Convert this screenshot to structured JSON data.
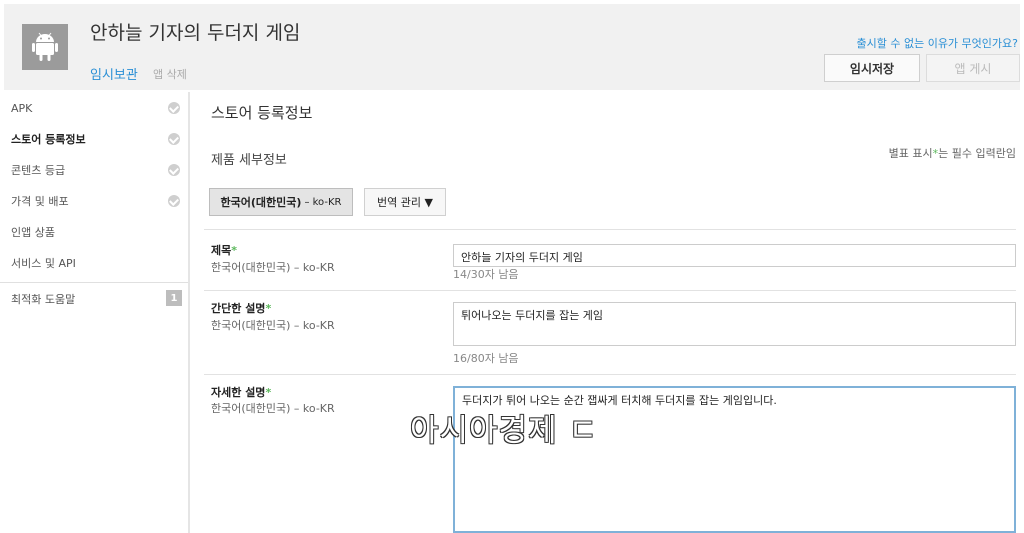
{
  "header": {
    "app_title": "안하늘 기자의 두더지 게임",
    "draft_label": "임시보관",
    "delete_label": "앱 삭제",
    "why_link": "출시할 수 없는 이유가 무엇인가요?",
    "save_label": "임시저장",
    "publish_label": "앱 게시"
  },
  "sidebar": {
    "items": [
      {
        "label": "APK",
        "checked": true
      },
      {
        "label": "스토어 등록정보",
        "checked": true,
        "active": true
      },
      {
        "label": "콘텐츠 등급",
        "checked": true
      },
      {
        "label": "가격 및 배포",
        "checked": true
      },
      {
        "label": "인앱 상품",
        "checked": false
      },
      {
        "label": "서비스 및 API",
        "checked": false
      }
    ],
    "optimization": {
      "label": "최적화 도움말",
      "count": "1"
    }
  },
  "main": {
    "section_title": "스토어 등록정보",
    "sub_title": "제품 세부정보",
    "required_note_prefix": "별표 표시",
    "required_note_star": "*",
    "required_note_suffix": "는 필수 입력란임",
    "language_button": {
      "name": "한국어(대한민국)",
      "code": "– ko-KR"
    },
    "translation_button": "번역 관리 ▼",
    "fields": [
      {
        "label": "제목",
        "star": "*",
        "lang": "한국어(대한민국) – ko-KR",
        "value": "안하늘 기자의 두더지 게임",
        "counter": "14/30자 남음"
      },
      {
        "label": "간단한 설명",
        "star": "*",
        "lang": "한국어(대한민국) – ko-KR",
        "value": "튀어나오는 두더지를 잡는 게임",
        "counter": "16/80자 남음"
      },
      {
        "label": "자세한 설명",
        "star": "*",
        "lang": "한국어(대한민국) – ko-KR",
        "value": "두더지가 튀어 나오는 순간 잽싸게 터치해 두더지를 잡는 게임입니다."
      }
    ]
  },
  "watermark": "아시아경제 ㄷ",
  "colors": {
    "accent_blue": "#2a8fd5",
    "required_green": "#5cb85c",
    "header_bg": "#f1f1f1",
    "focus_border": "#7fb1d8"
  },
  "icons": {
    "app_icon": "android-icon",
    "check_icon": "check-circle-icon"
  }
}
